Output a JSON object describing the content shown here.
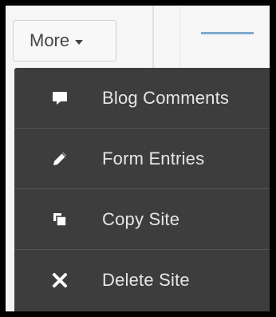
{
  "toolbar": {
    "more_label": "More"
  },
  "menu": {
    "items": [
      {
        "label": "Blog Comments",
        "icon": "comment-icon"
      },
      {
        "label": "Form Entries",
        "icon": "pencil-icon"
      },
      {
        "label": "Copy Site",
        "icon": "copy-icon"
      },
      {
        "label": "Delete Site",
        "icon": "close-icon"
      }
    ]
  },
  "colors": {
    "menu_background": "#3d3d3d",
    "menu_text": "#e6e6e6",
    "accent_underline": "#7fa8cf"
  }
}
